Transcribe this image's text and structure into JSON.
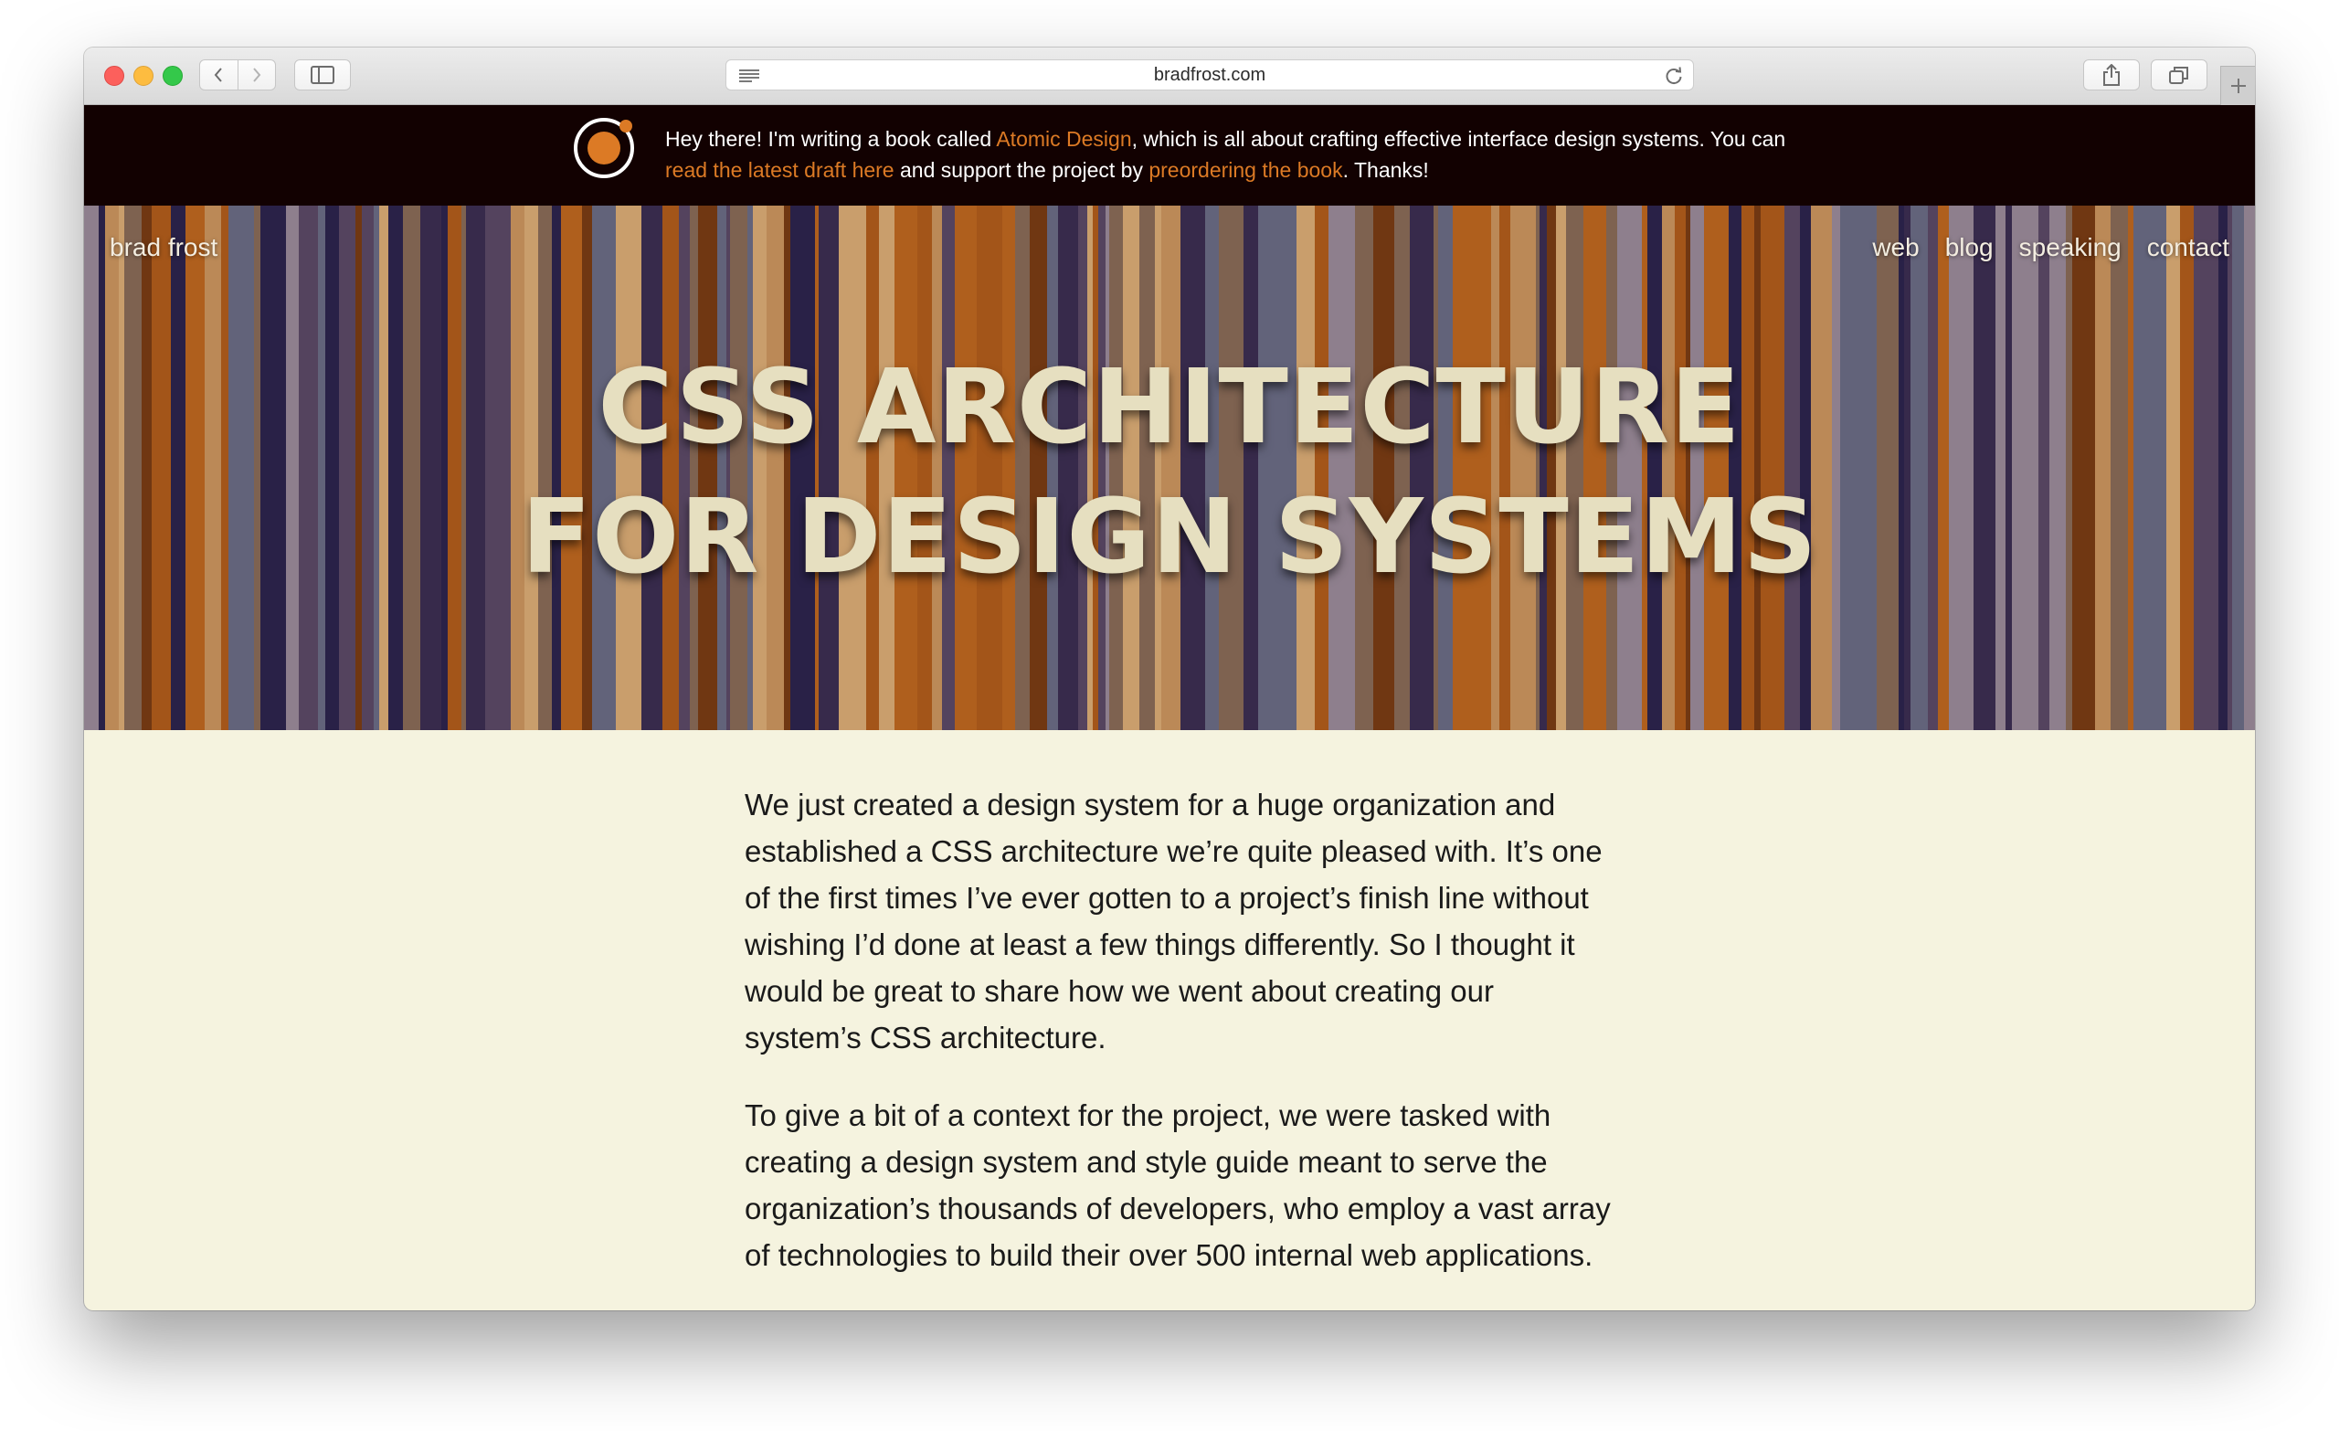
{
  "browser": {
    "url": "bradfrost.com"
  },
  "announcement": {
    "part1": "Hey there! I'm writing a book called ",
    "link1": "Atomic Design",
    "part2": ", which is all about crafting effective interface design systems. You can ",
    "link2": "read the latest draft here",
    "part3": " and support the project by ",
    "link3": "preordering the book",
    "part4": ". Thanks!"
  },
  "site": {
    "brand": "brad frost",
    "nav": [
      "web",
      "blog",
      "speaking",
      "contact"
    ]
  },
  "hero": {
    "title_line1": "CSS ARCHITECTURE",
    "title_line2": "FOR DESIGN SYSTEMS"
  },
  "article": {
    "paragraphs": [
      "We just created a design system for a huge organization and established a CSS architecture we’re quite pleased with. It’s one of the first times I’ve ever gotten to a project’s finish line without wishing I’d done at least a few things differently. So I thought it would be great to share how we went about creating our system’s CSS architecture.",
      "To give a bit of a context for the project, we were tasked with creating a design system and style guide meant to serve the organization’s thousands of developers, who employ a vast array of technologies to build their over 500 internal web applications."
    ]
  },
  "colors": {
    "announcement_bg": "#120101",
    "link_orange": "#dc7a25",
    "page_bg": "#f5f3df",
    "hero_orange": "#b45f1c",
    "hero_navy": "#2a2450",
    "title_cream": "#e6dfc0"
  },
  "icons": [
    "back-icon",
    "forward-icon",
    "sidebar-icon",
    "reader-icon",
    "reload-icon",
    "share-icon",
    "tabs-icon",
    "new-tab-icon",
    "atomic-logo-icon"
  ]
}
